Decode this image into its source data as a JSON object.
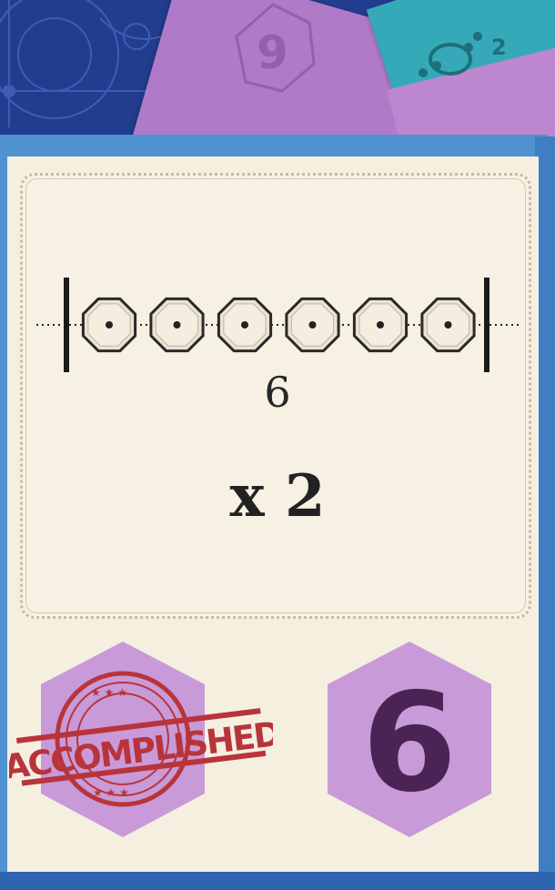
{
  "card": {
    "track_count": "6",
    "multiplier": "x 2",
    "stamp_text": "ACCOMPLISHED",
    "score_value": "6"
  },
  "icons": [
    "octagon-token-icon",
    "accomplished-stamp-icon",
    "score-hexagon-icon"
  ],
  "colors": {
    "background_blue": "#223d8f",
    "card_cream": "#f5efe0",
    "stamp_red": "#b8343b",
    "hex_purple": "#c89ad8",
    "score_purple": "#4a2455",
    "back_purple_card": "#b07ac9",
    "back_teal_card": "#35a9b8"
  }
}
